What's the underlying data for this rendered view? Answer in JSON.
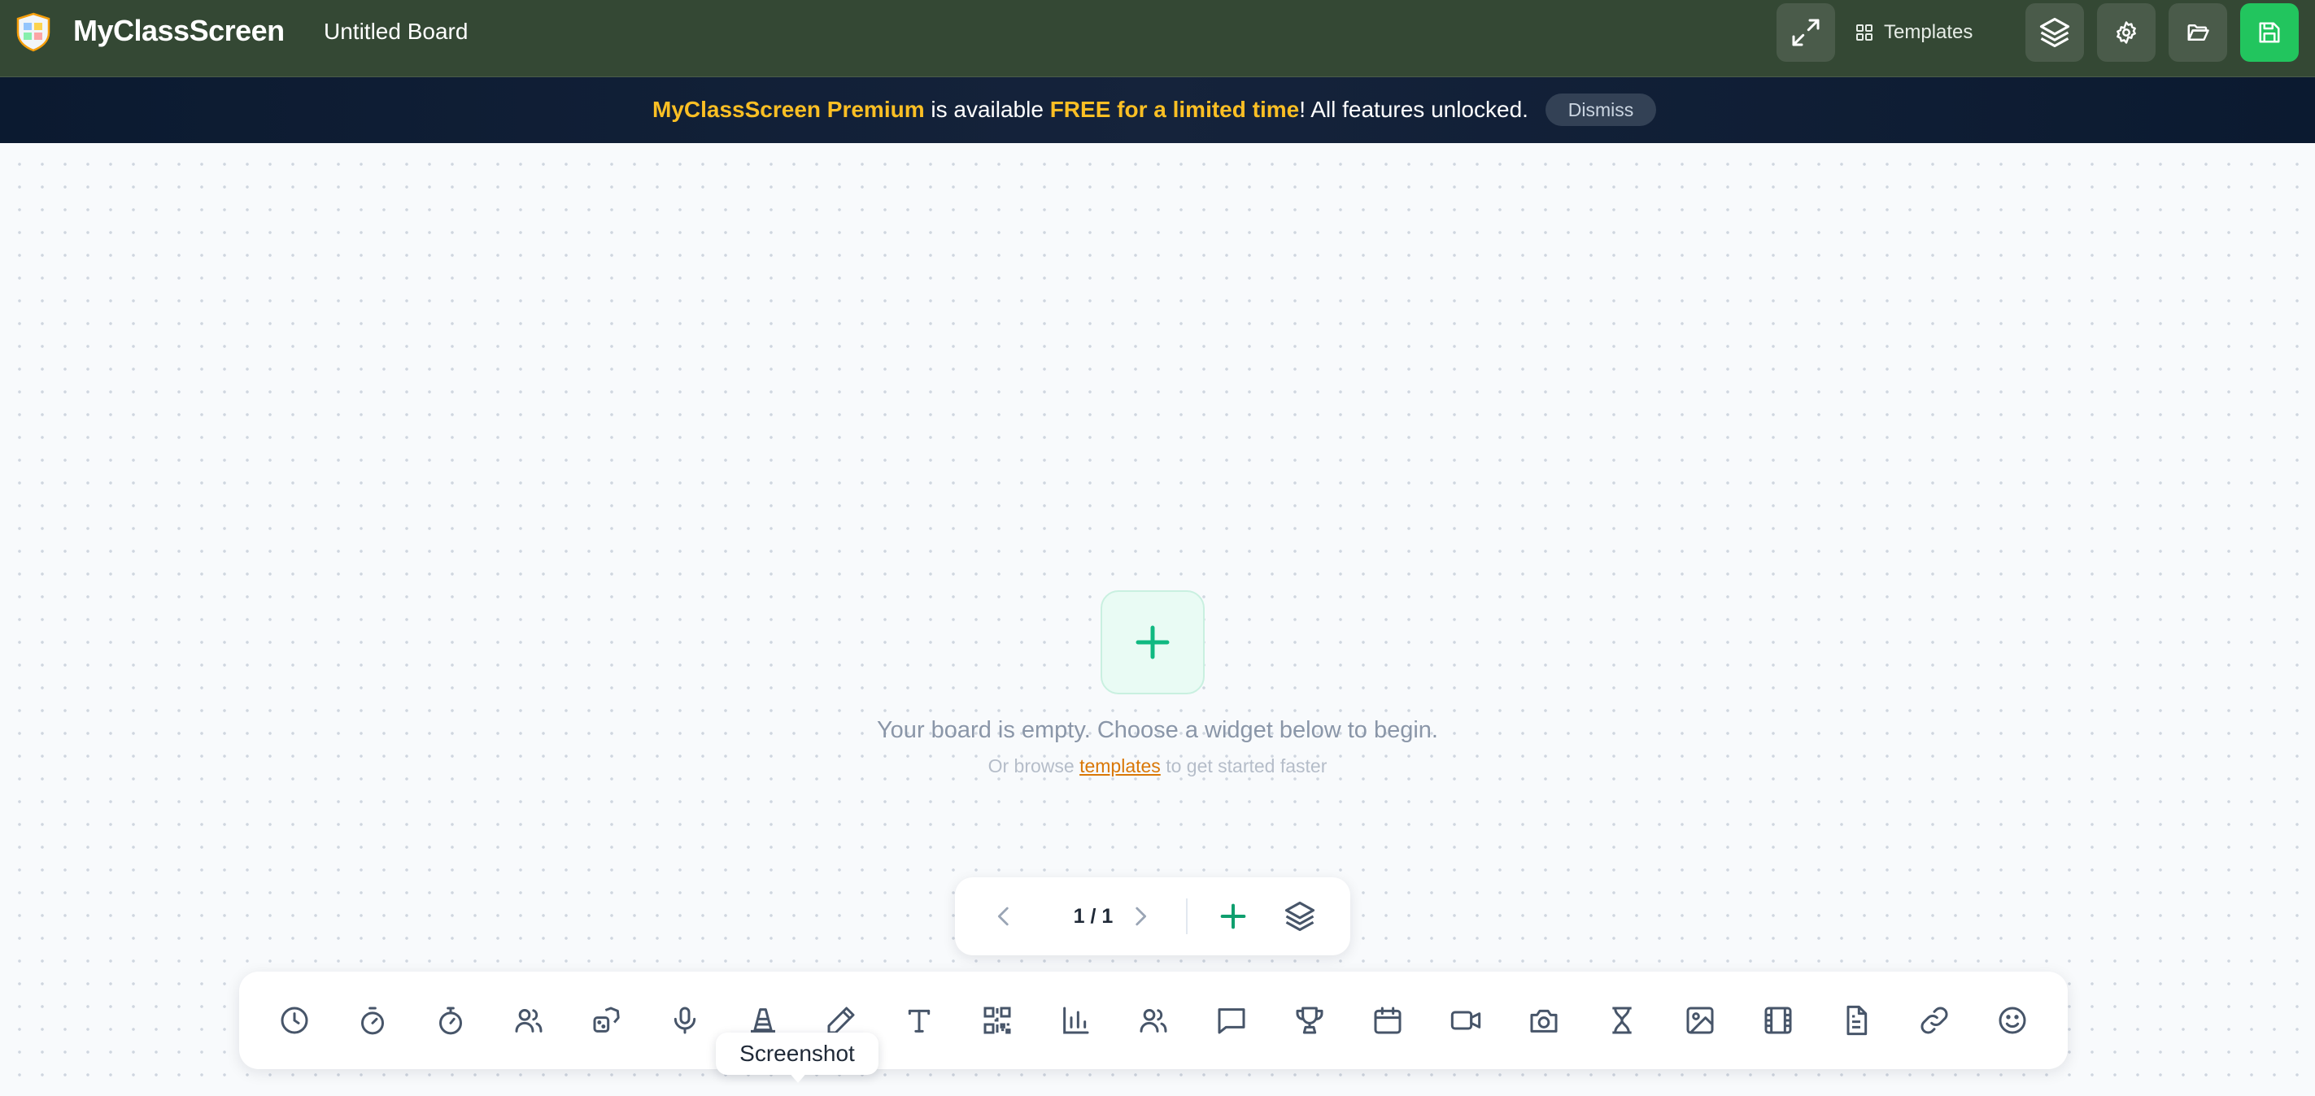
{
  "header": {
    "app_name": "MyClassScreen",
    "board_title": "Untitled Board",
    "templates_label": "Templates",
    "colors": {
      "background": "#344834",
      "save": "#22c55e"
    },
    "icons": [
      "fullscreen-icon",
      "templates-grid-icon",
      "layers-icon",
      "gear-icon",
      "folder-icon",
      "save-icon"
    ]
  },
  "banner": {
    "premium_name": "MyClassScreen Premium",
    "text_mid": " is available ",
    "free_text": "FREE for a limited time",
    "text_end": "! All features unlocked.",
    "dismiss_label": "Dismiss",
    "highlight_color": "#fbbf24"
  },
  "empty_state": {
    "message": "Your board is empty. Choose a widget below to begin.",
    "sub_before": "Or browse ",
    "sub_link": "templates",
    "sub_after": " to get started faster"
  },
  "pager": {
    "indicator": "1 / 1",
    "icons": [
      "chevron-left-icon",
      "chevron-right-icon",
      "add-page-icon",
      "layers-icon"
    ]
  },
  "toolbar": {
    "tools": [
      "clock",
      "timer",
      "stopwatch",
      "group-maker",
      "dice",
      "sound-level",
      "traffic-cone",
      "draw",
      "text",
      "qr-code",
      "poll",
      "name-picker",
      "chat",
      "trophy",
      "calendar",
      "video",
      "screenshot",
      "hourglass",
      "image",
      "film",
      "document",
      "link",
      "emoji"
    ],
    "tooltip": "Screenshot"
  }
}
